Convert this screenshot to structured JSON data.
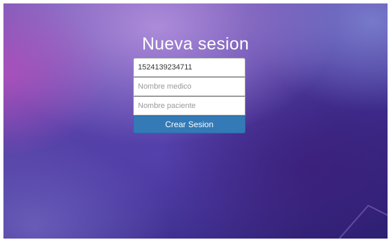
{
  "page": {
    "title": "Nueva sesion"
  },
  "form": {
    "session_id": {
      "value": "1524139234711"
    },
    "doctor_name": {
      "placeholder": "Nombre medico"
    },
    "patient_name": {
      "placeholder": "Nombre paciente"
    },
    "submit_label": "Crear Sesion"
  },
  "colors": {
    "button": "#337ab7",
    "title_text": "#ffffff"
  }
}
